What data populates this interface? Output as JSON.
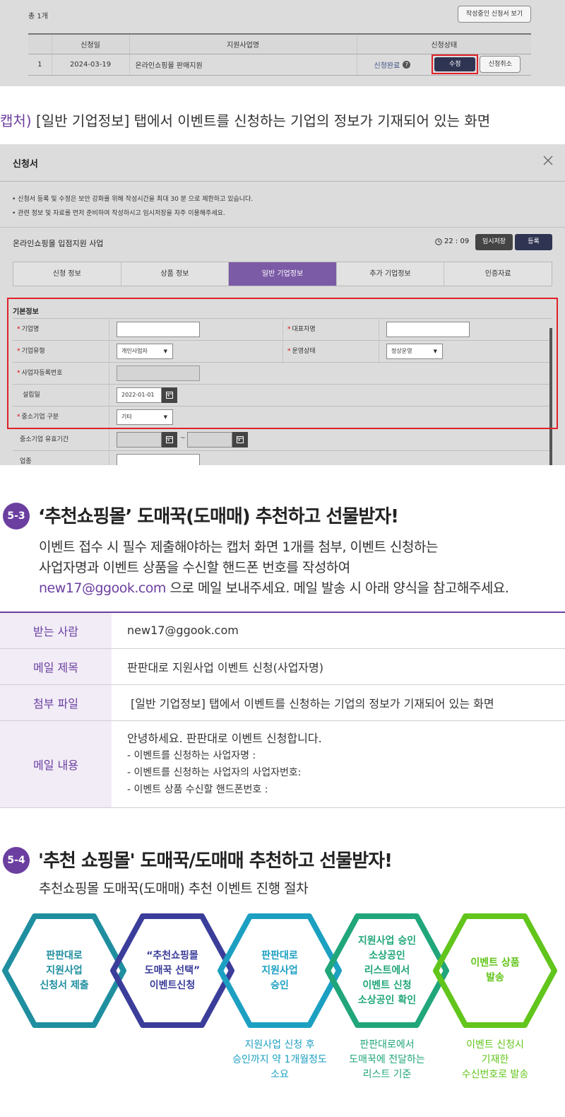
{
  "top_panel": {
    "total_count": "총 1개",
    "view_drafts_button": "작성중인 신청서 보기",
    "headers": [
      "신청일",
      "지원사업명",
      "신청상태"
    ],
    "row": {
      "num": "1",
      "date": "2024-03-19",
      "name": "온라인쇼핑몰 판매지원",
      "status": "신청완료",
      "edit_button": "수정",
      "cancel_button": "신청취소"
    }
  },
  "caption_1": {
    "accent": "캡처)",
    "text": " [일반 기업정보] 탭에서 이벤트를 신청하는 기업의 정보가 기재되어 있는 화면"
  },
  "modal": {
    "title": "신청서",
    "notices": [
      "• 신청서 등록 및 수정은 보안 강화를 위해 작성시간을 최대 30 분 으로 제한하고 있습니다.",
      "• 관련 정보 및 자료를 먼저 준비하여 작성하시고 임시저장을 자주 이용해주세요."
    ],
    "program_name": "온라인쇼핑몰 입점지원 사업",
    "timer": "22 : 09",
    "save_temp_button": "임시저장",
    "register_button": "등록",
    "tabs": [
      "신청 정보",
      "상품 정보",
      "일반 기업정보",
      "추가 기업정보",
      "인증자료"
    ],
    "active_tab": 2,
    "section_title": "기본정보",
    "fields": {
      "company_name": "기업명",
      "ceo_name": "대표자명",
      "company_type": "기업유형",
      "company_type_value": "개인사업자",
      "operation_status": "운영상태",
      "operation_status_value": "정상운영",
      "biz_reg_no": "사업자등록번호",
      "founded_date": "설립일",
      "founded_date_value": "2022-01-01",
      "sme_type": "중소기업 구분",
      "sme_type_value": "기타",
      "sme_valid_period": "중소기업 유효기간",
      "tilde": "~",
      "industry": "업종"
    },
    "required_mark": "*"
  },
  "section_53": {
    "badge": "5-3",
    "title": "‘추천쇼핑몰’ 도매꾹(도매매) 추천하고 선물받자!",
    "desc_line1": "이벤트 접수 시 필수 제출해야하는 캡처 화면 1개를 첨부, 이벤트 신청하는",
    "desc_line2": "사업자명과 이벤트 상품을 수신할 핸드폰 번호를 작성하여",
    "desc_email": "new17@ggook.com",
    "desc_line3_rest": " 으로 메일 보내주세요. 메일 발송 시 아래 양식을 참고해주세요.",
    "mail_table": {
      "recipient_label": "받는 사람",
      "recipient_value": "new17@ggook.com",
      "subject_label": "메일 제목",
      "subject_value": "판판대로 지원사업 이벤트 신청(사업자명)",
      "attachment_label": "첨부 파일",
      "attachment_value": "[일반 기업정보] 탭에서 이벤트를 신청하는 기업의 정보가 기재되어 있는 화면",
      "body_label": "메일 내용",
      "body_line1": "안녕하세요. 판판대로 이벤트 신청합니다.",
      "body_line2": "- 이벤트를 신청하는 사업자명 :",
      "body_line3": "- 이벤트를 신청하는 사업자의 사업자번호:",
      "body_line4": "- 이벤트 상품 수신할 핸드폰번호 :"
    }
  },
  "section_54": {
    "badge": "5-4",
    "title": "'추천 쇼핑몰' 도매꾹/도매매 추천하고 선물받자!",
    "subtitle": "추천쇼핑몰 도매꾹(도매매) 추천 이벤트 진행 절차",
    "steps": [
      {
        "l1": "판판대로",
        "l2": "지원사업",
        "l3": "신청서 제출",
        "l4": "",
        "l5": "",
        "color": "#1f8fa0"
      },
      {
        "l1": "“추천쇼핑몰",
        "l2": "도매꾹 선택”",
        "l3": "이벤트신청",
        "l4": "",
        "l5": "",
        "color": "#3b3d9a"
      },
      {
        "l1": "판판대로",
        "l2": "지원사업",
        "l3": "승인",
        "l4": "",
        "l5": "",
        "color": "#1ca0c2"
      },
      {
        "l1": "지원사업 승인",
        "l2": "소상공인",
        "l3": "리스트에서",
        "l4": "이벤트 신청",
        "l5": "소상공인 확인",
        "color": "#20a67a"
      },
      {
        "l1": "이벤트 상품",
        "l2": "발송",
        "l3": "",
        "l4": "",
        "l5": "",
        "color": "#62c51b"
      }
    ],
    "notes": [
      {
        "l1": "지원사업 신청 후",
        "l2": "승인까지 약 1개월정도",
        "l3": "소요",
        "color": "#1ca0c2"
      },
      {
        "l1": "판판대로에서",
        "l2": "도매꾹에 전달하는",
        "l3": "리스트 기준",
        "color": "#20a67a"
      },
      {
        "l1": "이벤트 신청시",
        "l2": "기재한",
        "l3": "수신번호로 발송",
        "color": "#62c51b"
      }
    ]
  }
}
